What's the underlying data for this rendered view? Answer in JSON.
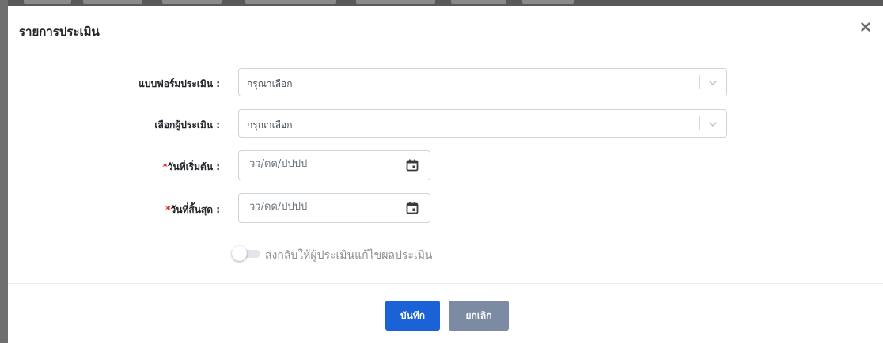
{
  "modal": {
    "title": "รายการประเมิน",
    "close_icon": "close-icon"
  },
  "form": {
    "evaluation_form": {
      "label": "แบบฟอร์มประเมิน :",
      "value": "กรุณาเลือก",
      "icon": "chevron-down-icon"
    },
    "evaluator": {
      "label": "เลือกผู้ประเมิน :",
      "value": "กรุณาเลือก",
      "icon": "chevron-down-icon"
    },
    "start_date": {
      "required_mark": "*",
      "label": "วันที่เริ่มต้น :",
      "placeholder": "วว/ดด/ปปปป",
      "icon": "calendar-icon"
    },
    "end_date": {
      "required_mark": "*",
      "label": "วันที่สิ้นสุด :",
      "placeholder": "วว/ดด/ปปปป",
      "icon": "calendar-icon"
    },
    "return_toggle": {
      "label": "ส่งกลับให้ผู้ประเมินแก้ไขผลประเมิน",
      "checked": false
    }
  },
  "footer": {
    "save_label": "บันทึก",
    "cancel_label": "ยกเลิก"
  },
  "colors": {
    "primary": "#1a62d6",
    "secondary": "#7c8aa3",
    "required": "#e02424",
    "border": "#ced4da"
  }
}
